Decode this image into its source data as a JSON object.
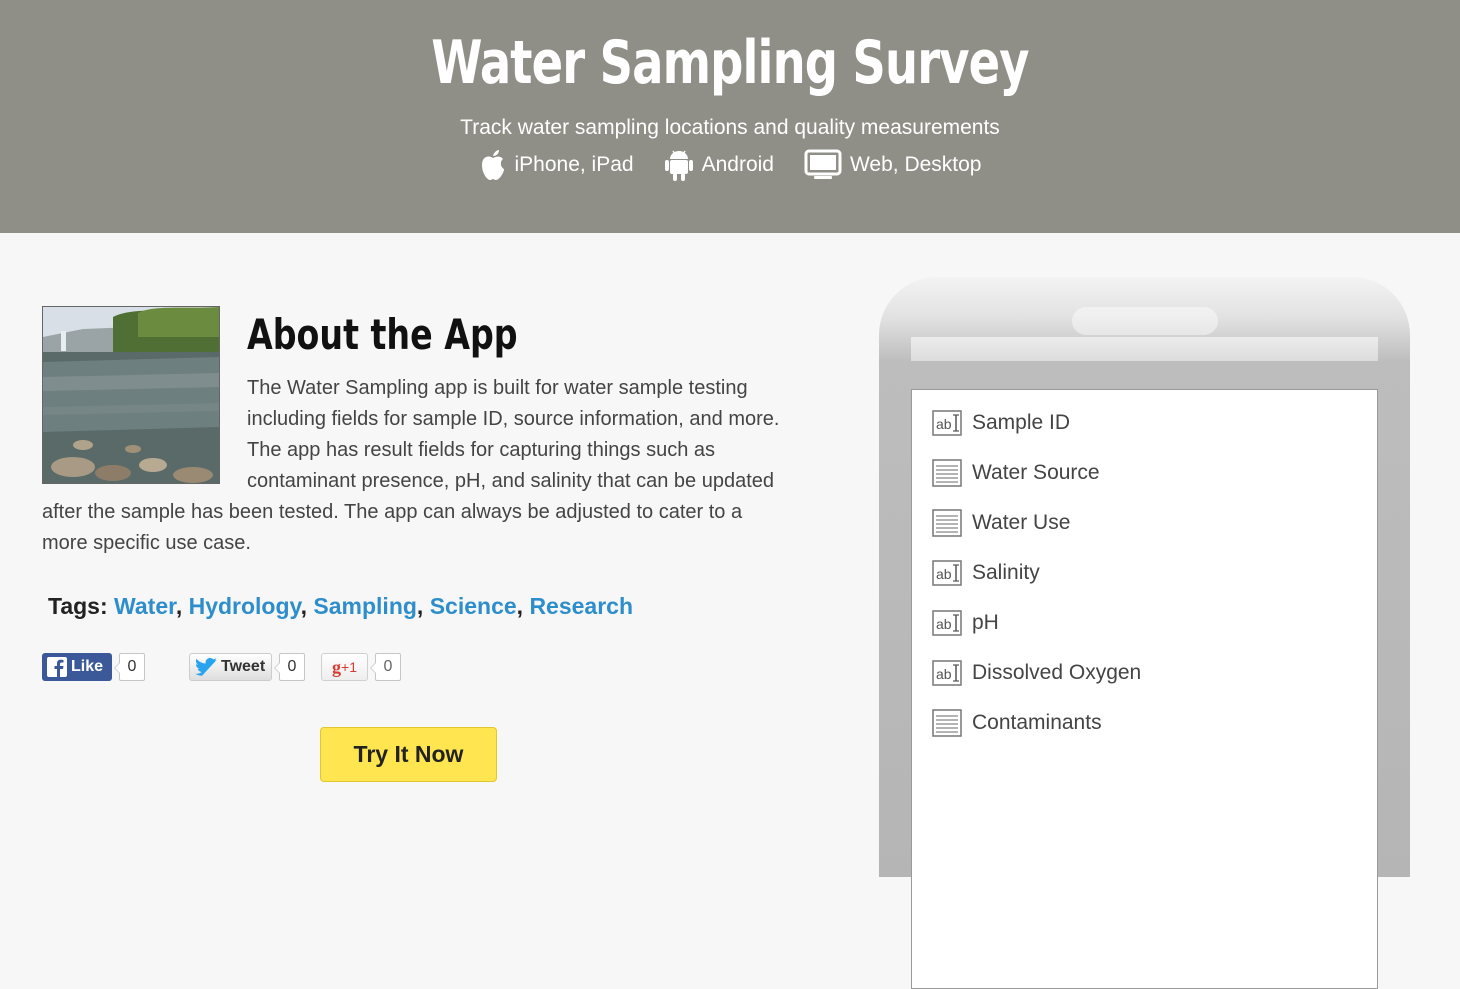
{
  "hero": {
    "title": "Water Sampling Survey",
    "tagline": "Track water sampling locations and quality measurements",
    "platforms": [
      {
        "icon": "apple-icon",
        "label": "iPhone, iPad"
      },
      {
        "icon": "android-icon",
        "label": "Android"
      },
      {
        "icon": "desktop-icon",
        "label": "Web, Desktop"
      }
    ]
  },
  "about": {
    "title": "About the App",
    "body": "The Water Sampling app is built for water sample testing including fields for sample ID, source information, and more. The app has result fields for capturing things such as contaminant presence, pH, and salinity that can be updated after the sample has been tested. The app can always be adjusted to cater to a more specific use case."
  },
  "tags": {
    "label": "Tags:",
    "items": [
      "Water",
      "Hydrology",
      "Sampling",
      "Science",
      "Research"
    ],
    "color": "#2e8ecb"
  },
  "social": {
    "like_label": "Like",
    "like_count": "0",
    "tweet_label": "Tweet",
    "tweet_count": "0",
    "gplus_label": "+1",
    "gplus_count": "0"
  },
  "cta": {
    "label": "Try It Now",
    "color": "#ffe651"
  },
  "phone": {
    "fields": [
      {
        "type": "text-field-icon",
        "label": "Sample ID"
      },
      {
        "type": "paragraph-field-icon",
        "label": "Water Source"
      },
      {
        "type": "paragraph-field-icon",
        "label": "Water Use"
      },
      {
        "type": "text-field-icon",
        "label": "Salinity"
      },
      {
        "type": "text-field-icon",
        "label": "pH"
      },
      {
        "type": "text-field-icon",
        "label": "Dissolved Oxygen"
      },
      {
        "type": "paragraph-field-icon",
        "label": "Contaminants"
      }
    ]
  },
  "colors": {
    "hero_bg": "#8f8f88",
    "link": "#2e8ecb",
    "cta": "#ffe651"
  }
}
